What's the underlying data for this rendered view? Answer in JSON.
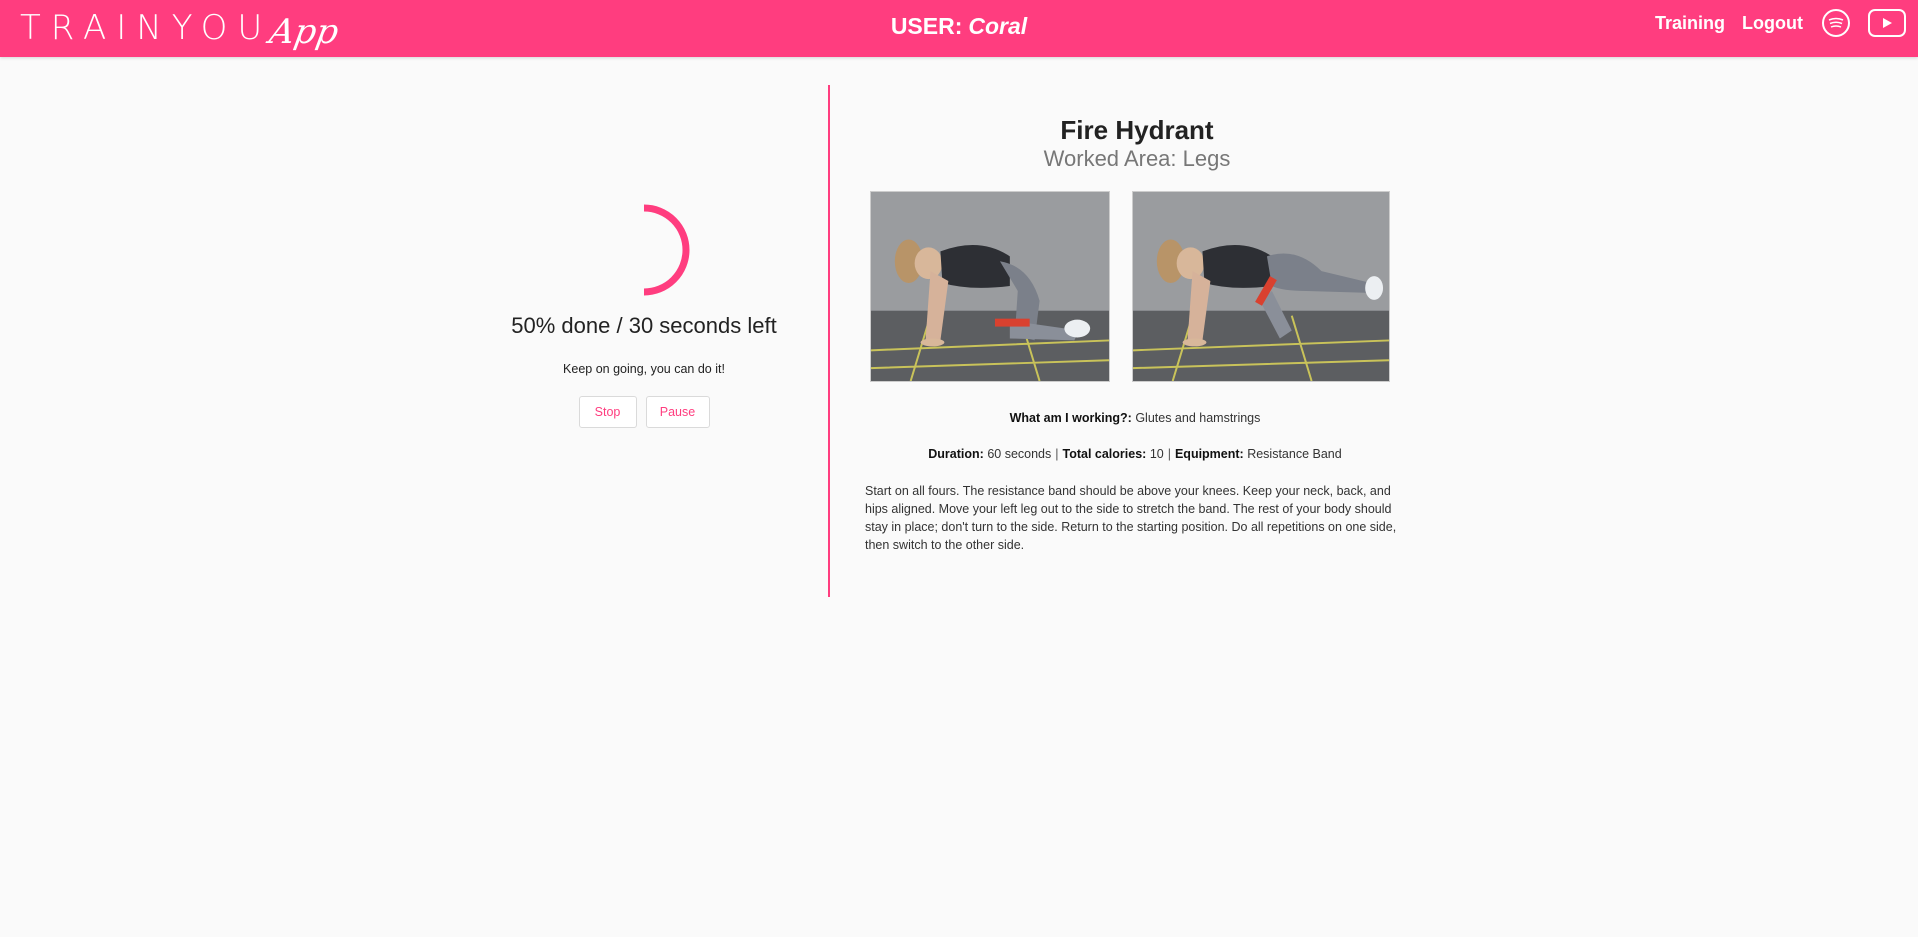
{
  "header": {
    "logo_main": "TRAINYOU",
    "logo_sub": "App",
    "user_label": "USER:",
    "user_name": "Coral",
    "nav": {
      "training": "Training",
      "logout": "Logout"
    },
    "icons": [
      "spotify-icon",
      "youtube-icon"
    ],
    "colors": {
      "accent": "#ff3d7f",
      "background": "#fafafa"
    }
  },
  "workout": {
    "progress_percent": 50,
    "status": "50% done / 30 seconds left",
    "motivation": "Keep on going, you can do it!",
    "stop_label": "Stop",
    "pause_label": "Pause"
  },
  "exercise": {
    "title": "Fire Hydrant",
    "worked_area": "Worked Area: Legs",
    "working_label": "What am I working?:",
    "working_value": "Glutes and hamstrings",
    "duration_label": "Duration:",
    "duration_value": "60 seconds",
    "calories_label": "Total calories:",
    "calories_value": "10",
    "equipment_label": "Equipment:",
    "equipment_value": "Resistance Band",
    "description": "Start on all fours. The resistance band should be above your knees. Keep your neck, back, and hips aligned. Move your left leg out to the side to stretch the band. The rest of your body should stay in place; don't turn to the side. Return to the starting position. Do all repetitions on one side, then switch to the other side."
  }
}
